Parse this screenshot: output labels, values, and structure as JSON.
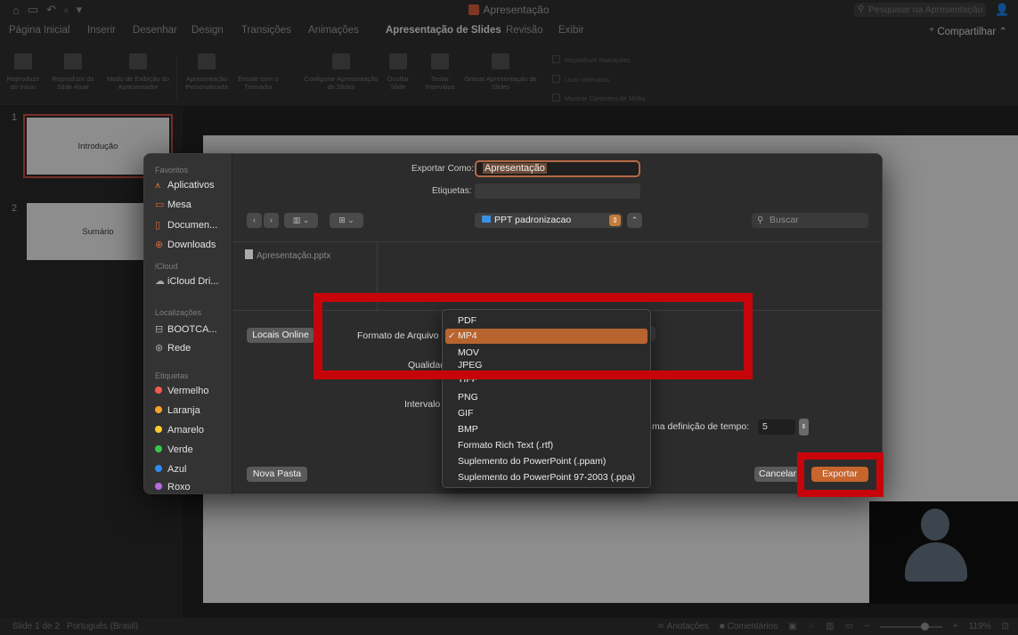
{
  "window": {
    "title": "Apresentação",
    "search_placeholder": "Pesquisar na Apresentação"
  },
  "ribbon_tabs": [
    "Página Inicial",
    "Inserir",
    "Desenhar",
    "Design",
    "Transições",
    "Animações",
    "Apresentação de Slides",
    "Revisão",
    "Exibir"
  ],
  "active_tab": "Apresentação de Slides",
  "share_label": "Compartilhar",
  "ribbon_buttons": [
    "Reproduzir do Início",
    "Reproduzir do Slide Atual",
    "Modo de Exibição do Apresentador",
    "Apresentação Personalizada",
    "Ensaie com o Treinador",
    "Configurar Apresentação de Slides",
    "Ocultar Slide",
    "Testar Intervalos",
    "Gravar Apresentação de Slides"
  ],
  "ribbon_checks": [
    "Reproduzir Narrações",
    "Usar intervalos",
    "Mostrar Controles de Mídia"
  ],
  "slides": [
    {
      "num": "1",
      "title": "Introdução"
    },
    {
      "num": "2",
      "title": "Sumário"
    }
  ],
  "dialog": {
    "export_as_label": "Exportar Como:",
    "export_as_value": "Apresentação",
    "tags_label": "Etiquetas:",
    "folder": "PPT padronizacao",
    "search_placeholder": "Buscar",
    "file_name": "Apresentação.pptx",
    "online_locations": "Locais Online",
    "format_label": "Formato de Arquivo",
    "quality_label": "Qualidade",
    "interval_label": "Intervalo",
    "timing_label": "ma definição de tempo:",
    "timing_value": "5",
    "new_folder": "Nova Pasta",
    "cancel": "Cancelar",
    "export": "Exportar"
  },
  "sidebar": {
    "favorites_title": "Favoritos",
    "favorites": [
      "Aplicativos",
      "Mesa",
      "Documen...",
      "Downloads"
    ],
    "icloud_title": "iCloud",
    "icloud": [
      "iCloud Dri..."
    ],
    "locations_title": "Localizações",
    "locations": [
      "BOOTCA...",
      "Rede"
    ],
    "tags_title": "Etiquetas",
    "tags": [
      {
        "name": "Vermelho",
        "color": "#f25a4e"
      },
      {
        "name": "Laranja",
        "color": "#f7a228"
      },
      {
        "name": "Amarelo",
        "color": "#f9cd2e"
      },
      {
        "name": "Verde",
        "color": "#34c84a"
      },
      {
        "name": "Azul",
        "color": "#2f8cf2"
      },
      {
        "name": "Roxo",
        "color": "#b86ae0"
      }
    ]
  },
  "format_menu": {
    "items": [
      "PDF",
      "MP4",
      "MOV",
      "JPEG",
      "TIFF",
      "PNG",
      "GIF",
      "BMP",
      "Formato Rich Text (.rtf)",
      "Suplemento do PowerPoint (.ppam)",
      "Suplemento do PowerPoint 97-2003 (.ppa)"
    ],
    "selected": "MP4",
    "check": "✓"
  },
  "statusbar": {
    "slide_info": "Slide 1 de 2",
    "language": "Português (Brasil)",
    "notes": "Anotações",
    "comments": "Comentários",
    "zoom": "119%"
  },
  "colors": {
    "accent": "#c7652d",
    "annotation_red": "#c8040b"
  }
}
